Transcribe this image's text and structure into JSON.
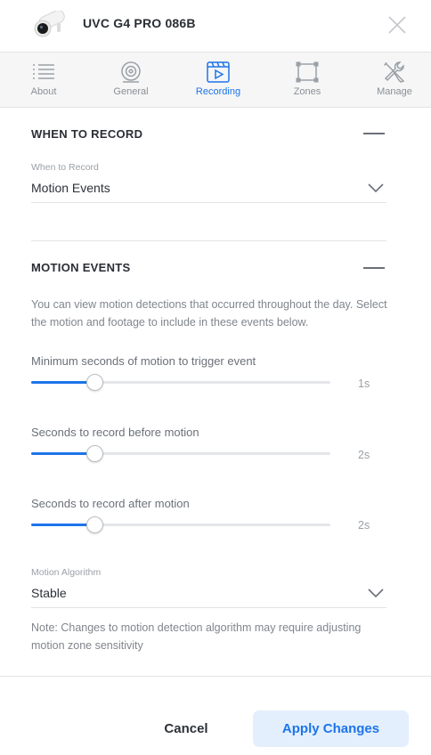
{
  "header": {
    "device_name": "UVC G4 PRO 086B",
    "camera_icon": "camera-icon",
    "close_icon": "close-icon"
  },
  "tabs": [
    {
      "label": "About",
      "icon": "list-icon",
      "active": false
    },
    {
      "label": "General",
      "icon": "camera-lens-icon",
      "active": false
    },
    {
      "label": "Recording",
      "icon": "recording-icon",
      "active": true
    },
    {
      "label": "Zones",
      "icon": "zones-icon",
      "active": false
    },
    {
      "label": "Manage",
      "icon": "tools-icon",
      "active": false
    }
  ],
  "when_to_record": {
    "title": "WHEN TO RECORD",
    "field_label": "When to Record",
    "value": "Motion Events"
  },
  "motion_events": {
    "title": "MOTION EVENTS",
    "description": "You can view motion detections that occurred throughout the day. Select the motion and footage to include in these events below.",
    "sliders": [
      {
        "label": "Minimum seconds of motion to trigger event",
        "value_text": "1s",
        "fraction": 0.21
      },
      {
        "label": "Seconds to record before motion",
        "value_text": "2s",
        "fraction": 0.21
      },
      {
        "label": "Seconds to record after motion",
        "value_text": "2s",
        "fraction": 0.21
      }
    ],
    "algorithm": {
      "field_label": "Motion Algorithm",
      "value": "Stable"
    },
    "note": "Note: Changes to motion detection algorithm may require adjusting motion zone sensitivity"
  },
  "footer": {
    "cancel_label": "Cancel",
    "apply_label": "Apply Changes"
  },
  "colors": {
    "accent": "#1d74ea",
    "apply_bg": "#e3effc",
    "text": "#2d3138",
    "muted": "#80868d"
  }
}
